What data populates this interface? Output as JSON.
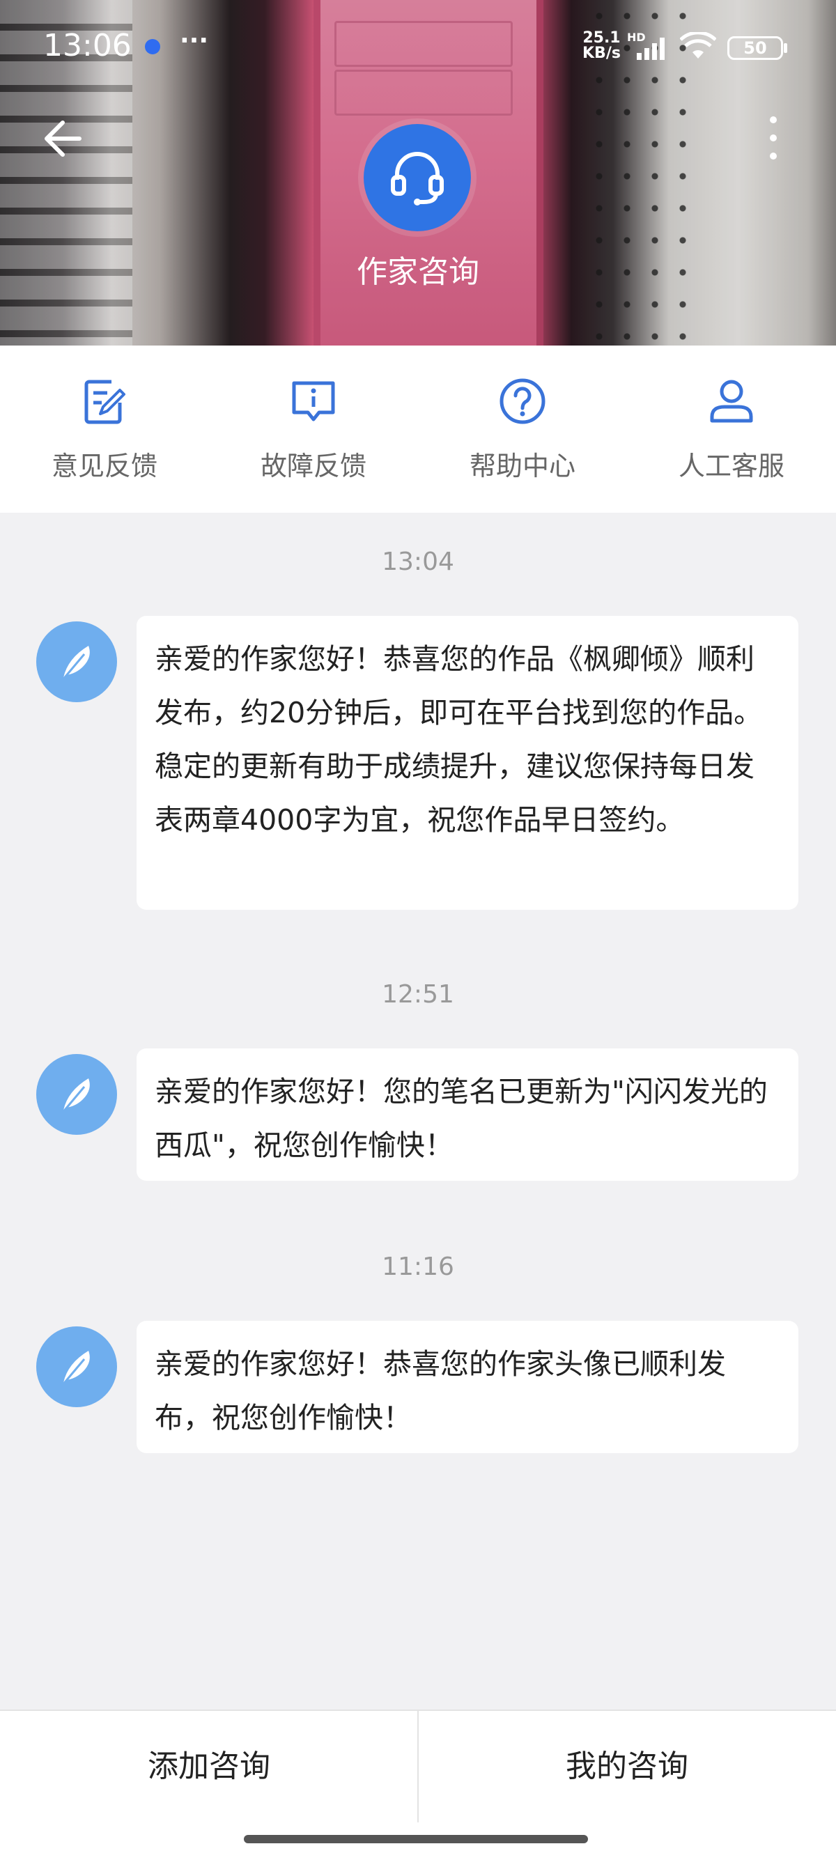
{
  "status_bar": {
    "time": "13:06",
    "more": "···",
    "net_speed_value": "25.1",
    "net_speed_unit": "KB/s",
    "network_type": "HD",
    "battery": "50"
  },
  "header": {
    "title": "作家咨询",
    "back_icon": "arrow-left-icon",
    "more_icon": "more-vertical-icon",
    "avatar_icon": "headset-icon",
    "avatar_color": "#2f74e4"
  },
  "quick_menu": [
    {
      "label": "意见反馈",
      "icon": "edit-document-icon"
    },
    {
      "label": "故障反馈",
      "icon": "info-message-icon"
    },
    {
      "label": "帮助中心",
      "icon": "question-circle-icon"
    },
    {
      "label": "人工客服",
      "icon": "person-icon"
    }
  ],
  "accent_color": "#3a73d9",
  "messages": [
    {
      "time": "13:04",
      "avatar_icon": "feather-icon",
      "text": "亲爱的作家您好！恭喜您的作品《枫卿倾》顺利发布，约20分钟后，即可在平台找到您的作品。稳定的更新有助于成绩提升，建议您保持每日发表两章4000字为宜，祝您作品早日签约。"
    },
    {
      "time": "12:51",
      "avatar_icon": "feather-icon",
      "text": "亲爱的作家您好！您的笔名已更新为\"闪闪发光的西瓜\"，祝您创作愉快！"
    },
    {
      "time": "11:16",
      "avatar_icon": "feather-icon",
      "text": "亲爱的作家您好！恭喜您的作家头像已顺利发布，祝您创作愉快！"
    }
  ],
  "bottom_bar": {
    "add_label": "添加咨询",
    "mine_label": "我的咨询"
  }
}
